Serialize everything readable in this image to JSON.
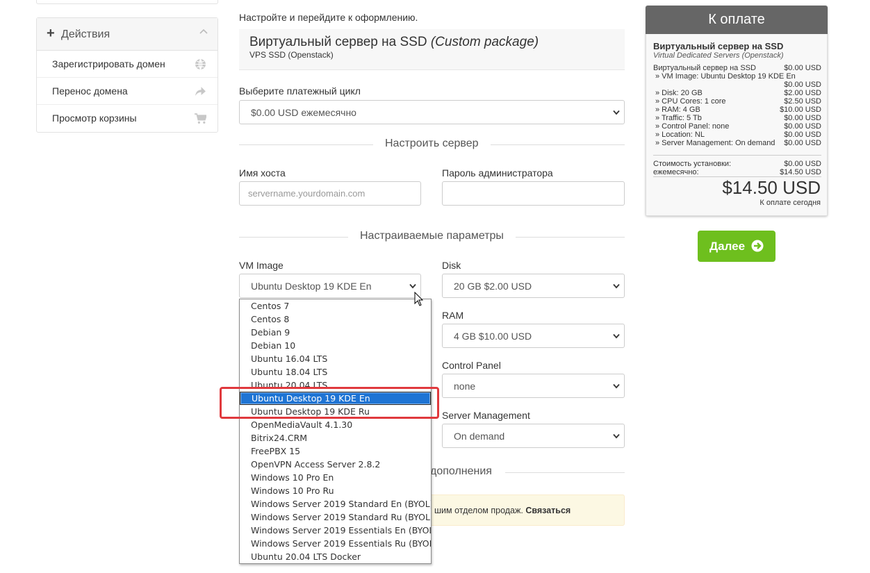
{
  "sidebar": {
    "header": "Действия",
    "items": [
      {
        "label": "Зарегистрировать домен",
        "icon": "globe-icon"
      },
      {
        "label": "Перенос домена",
        "icon": "share-arrow-icon"
      },
      {
        "label": "Просмотр корзины",
        "icon": "cart-icon"
      }
    ]
  },
  "main": {
    "intro": "Настройте и перейдите к оформлению.",
    "product": {
      "name": "Виртуальный сервер на SSD",
      "package": "(Custom package)",
      "group": "VPS SSD (Openstack)"
    },
    "billing": {
      "label": "Выберите платежный цикл",
      "value": "$0.00 USD ежемесячно"
    },
    "configure_server": "Настроить сервер",
    "hostname": {
      "label": "Имя хоста",
      "placeholder": "servername.yourdomain.com"
    },
    "root_password": {
      "label": "Пароль администратора",
      "value": ""
    },
    "configurable_options": "Настраиваемые параметры",
    "vm_image": {
      "label": "VM Image",
      "value": "Ubuntu Desktop 19 KDE En"
    },
    "disk": {
      "label": "Disk",
      "value": "20 GB $2.00 USD"
    },
    "ram": {
      "label": "RAM",
      "value": "4 GB $10.00 USD"
    },
    "control_panel": {
      "label": "Control Panel",
      "value": "none"
    },
    "server_management": {
      "label": "Server Management",
      "value": "On demand"
    },
    "addons_heading_partial": "дополнения",
    "notice": {
      "text": "шим отделом продаж. ",
      "link": "Связаться"
    }
  },
  "dropdown": {
    "options": [
      "Centos 7",
      "Centos 8",
      "Debian 9",
      "Debian 10",
      "Ubuntu 16.04 LTS",
      "Ubuntu 18.04 LTS",
      "Ubuntu 20.04 LTS",
      "Ubuntu Desktop 19 KDE En",
      "Ubuntu Desktop 19 KDE Ru",
      "OpenMediaVault 4.1.30",
      "Bitrix24.CRM",
      "FreePBX 15",
      "OpenVPN Access Server 2.8.2",
      "Windows 10 Pro En",
      "Windows 10 Pro Ru",
      "Windows Server 2019 Standard En (BYOL)",
      "Windows Server 2019 Standard Ru (BYOL)",
      "Windows Server 2019 Essentials En (BYOL)",
      "Windows Server 2019 Essentials Ru (BYOL)",
      "Ubuntu 20.04 LTS Docker"
    ],
    "selected_index": 7,
    "highlight_color": "#e0393d"
  },
  "summary": {
    "title": "К оплате",
    "product": "Виртуальный сервер на SSD",
    "group": "Virtual Dedicated Servers (Openstack)",
    "base_label": "Виртуальный сервер на SSD",
    "base_price": "$0.00 USD",
    "vm_image_label": "» VM Image: Ubuntu Desktop 19 KDE En",
    "vm_image_price": "$0.00 USD",
    "lines": [
      {
        "name": "» Disk: 20 GB",
        "price": "$2.00 USD"
      },
      {
        "name": "» CPU Cores: 1 core",
        "price": "$2.50 USD"
      },
      {
        "name": "» RAM: 4 GB",
        "price": "$10.00 USD"
      },
      {
        "name": "» Traffic: 5 Tb",
        "price": "$0.00 USD"
      },
      {
        "name": "» Control Panel: none",
        "price": "$0.00 USD"
      },
      {
        "name": "» Location: NL",
        "price": "$0.00 USD"
      },
      {
        "name": "» Server Management: On demand",
        "price": "$0.00 USD"
      }
    ],
    "setup_label": "Стоимость установки:",
    "setup_price": "$0.00 USD",
    "monthly_label": "ежемесячно:",
    "monthly_price": "$14.50 USD",
    "total": "$14.50 USD",
    "today_label": "К оплате сегодня"
  },
  "next_button": {
    "label": "Далее",
    "color": "#6ebf1e"
  }
}
